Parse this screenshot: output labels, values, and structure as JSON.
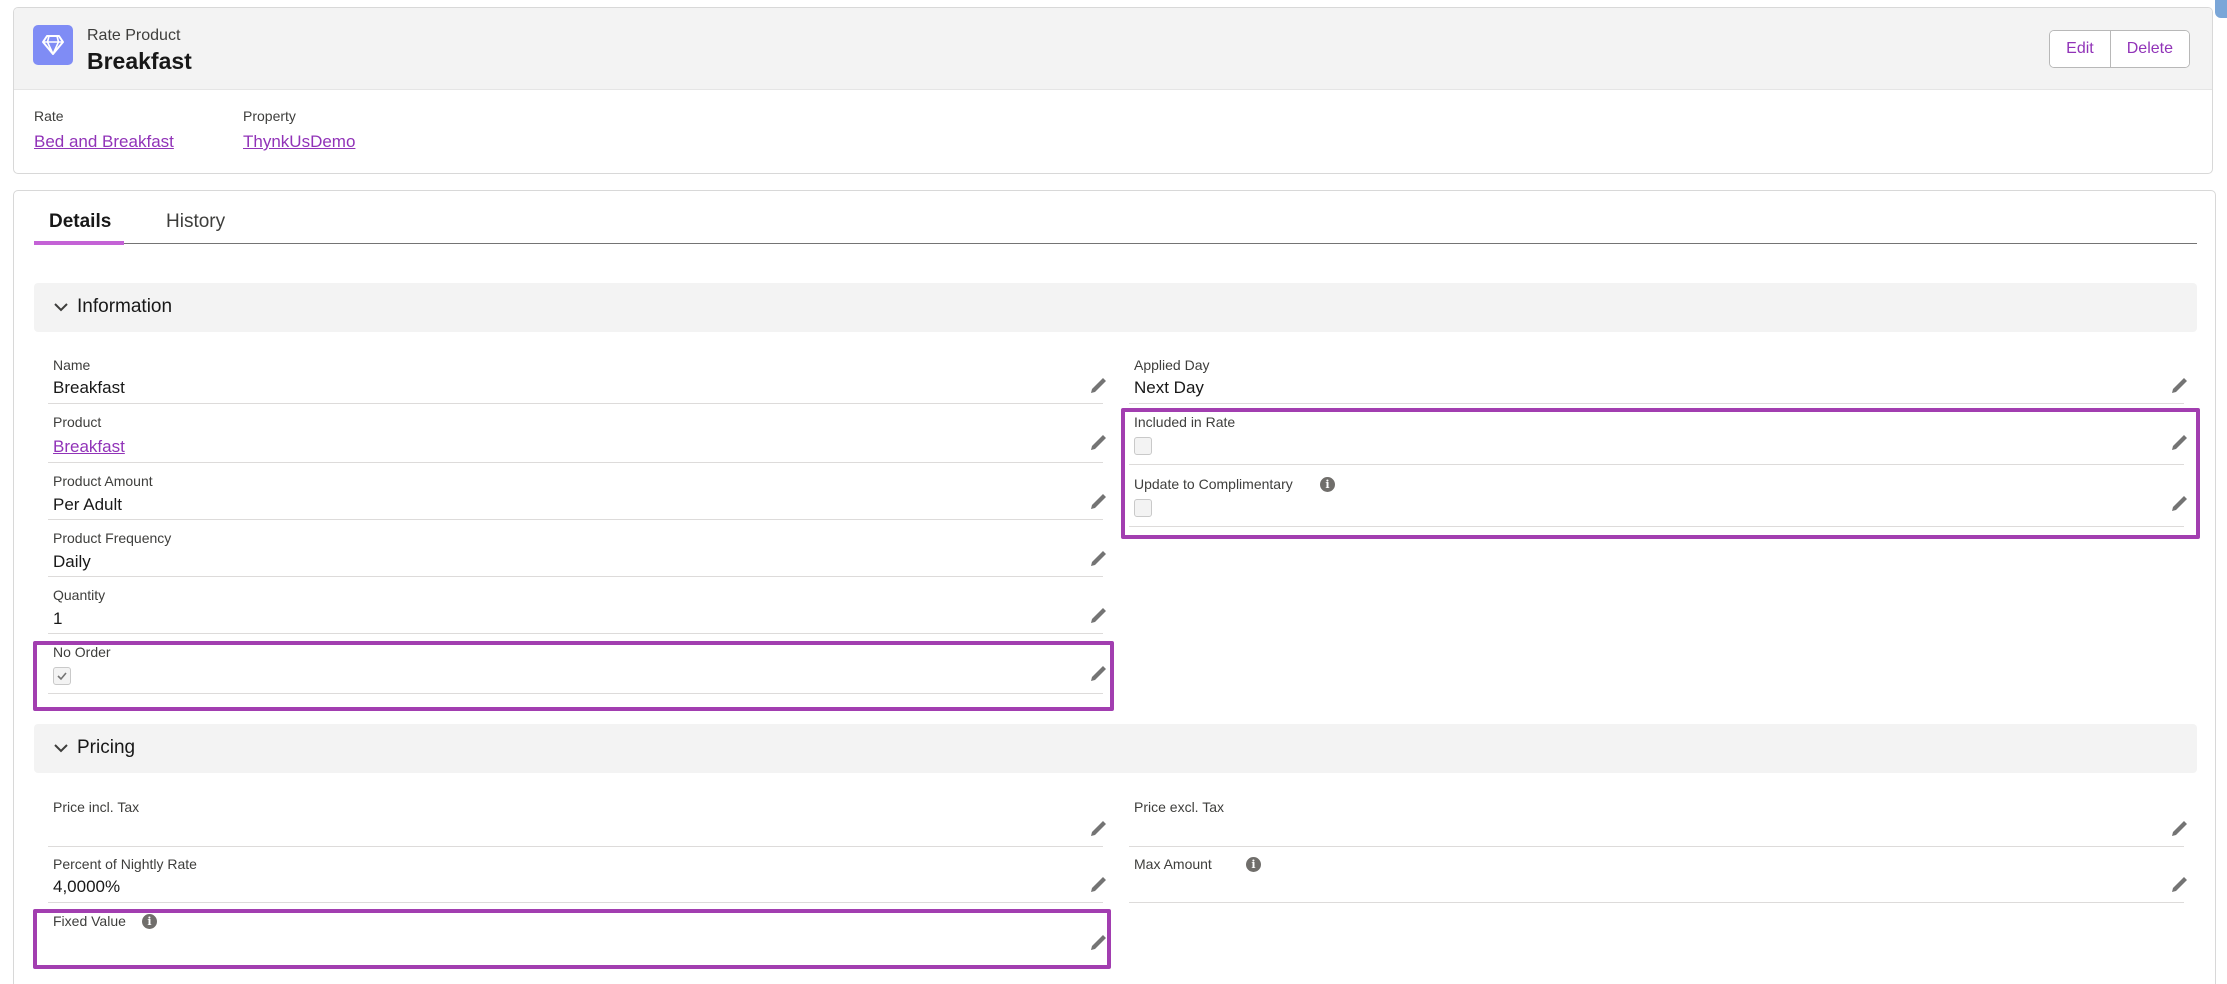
{
  "header": {
    "object_type": "Rate Product",
    "record_name": "Breakfast",
    "icon": "diamond-icon",
    "buttons": {
      "edit": "Edit",
      "delete": "Delete"
    },
    "highlights": [
      {
        "label": "Rate",
        "value": "Bed and Breakfast"
      },
      {
        "label": "Property",
        "value": "ThynkUsDemo"
      }
    ]
  },
  "tabs": {
    "details": "Details",
    "history": "History"
  },
  "sections": {
    "information": {
      "title": "Information",
      "left": [
        {
          "label": "Name",
          "value": "Breakfast"
        },
        {
          "label": "Product",
          "value": "Breakfast"
        },
        {
          "label": "Product Amount",
          "value": "Per Adult"
        },
        {
          "label": "Product Frequency",
          "value": "Daily"
        },
        {
          "label": "Quantity",
          "value": "1"
        },
        {
          "label": "No Order",
          "checked": true
        }
      ],
      "right": [
        {
          "label": "Applied Day",
          "value": "Next Day"
        },
        {
          "label": "Included in Rate",
          "checked": false
        },
        {
          "label": "Update to Complimentary",
          "checked": false
        }
      ]
    },
    "pricing": {
      "title": "Pricing",
      "left": [
        {
          "label": "Price incl. Tax",
          "value": ""
        },
        {
          "label": "Percent of Nightly Rate",
          "value": "4,0000%"
        },
        {
          "label": "Fixed Value",
          "value": ""
        }
      ],
      "right": [
        {
          "label": "Price excl. Tax",
          "value": ""
        },
        {
          "label": "Max Amount",
          "value": ""
        }
      ]
    }
  },
  "colors": {
    "accent": "#9133b8",
    "highlight_box": "#a23eb0",
    "tab_underline": "#c462d6",
    "icon_bg": "#7f8cf5"
  }
}
